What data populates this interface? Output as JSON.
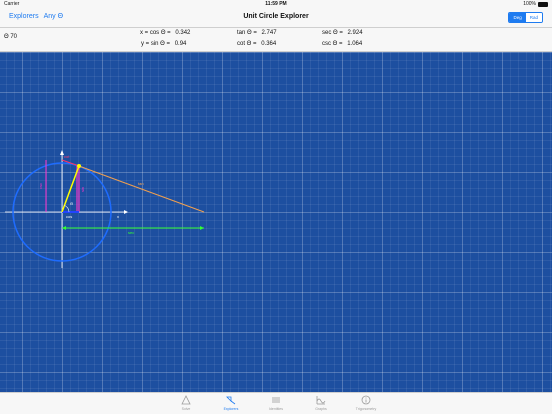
{
  "status": {
    "carrier": "Carrier",
    "time": "11:59 PM",
    "battery": "100%"
  },
  "nav": {
    "back_label": "Explorers",
    "filter_label": "Any Θ",
    "title": "Unit Circle Explorer",
    "segments": [
      "Deg",
      "Rad"
    ],
    "selected_segment": "Deg"
  },
  "info": {
    "theta": "Θ 70",
    "cos_label": "x = cos Θ =",
    "cos_value": "0.342",
    "sin_label": "y = sin Θ =",
    "sin_value": "0.94",
    "tan_label": "tan Θ =",
    "tan_value": "2.747",
    "cot_label": "cot Θ =",
    "cot_value": "0.364",
    "sec_label": "sec Θ =",
    "sec_value": "2.924",
    "csc_label": "csc Θ =",
    "csc_value": "1.064"
  },
  "diagram": {
    "angle_deg": 70,
    "label_sin": "sin",
    "label_cos": "cos",
    "label_tan": "tan",
    "label_sec": "sec",
    "label_cot": "cot",
    "label_csc": "csc",
    "label_theta": "Θ",
    "axis_x_label": "x",
    "colors": {
      "circle": "#1e6cff",
      "radius": "#ffff00",
      "sin": "#ff33cc",
      "cos": "#2244ff",
      "tan": "#f0a050",
      "sec": "#33ff33",
      "cot": "#ff3366",
      "axis": "#ffffff"
    }
  },
  "tabs": [
    {
      "label": "Solve",
      "icon": "triangle-icon"
    },
    {
      "label": "Explorers",
      "icon": "explorers-icon"
    },
    {
      "label": "Identities",
      "icon": "list-icon"
    },
    {
      "label": "Graphs",
      "icon": "graph-icon"
    },
    {
      "label": "Trigonometry",
      "icon": "info-icon"
    }
  ],
  "active_tab": "Explorers"
}
